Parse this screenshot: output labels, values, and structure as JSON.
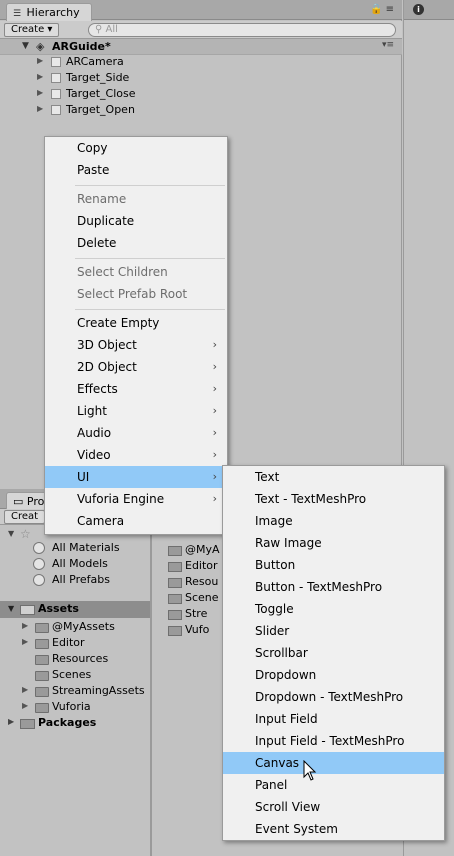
{
  "hierarchy": {
    "tab_label": "Hierarchy",
    "create_label": "Create ▾",
    "search_placeholder": "All",
    "scene_name": "ARGuide*",
    "items": [
      "ARCamera",
      "Target_Side",
      "Target_Close",
      "Target_Open"
    ]
  },
  "context_menu": {
    "copy": "Copy",
    "paste": "Paste",
    "rename": "Rename",
    "duplicate": "Duplicate",
    "delete": "Delete",
    "select_children": "Select Children",
    "select_prefab_root": "Select Prefab Root",
    "create_empty": "Create Empty",
    "object_3d": "3D Object",
    "object_2d": "2D Object",
    "effects": "Effects",
    "light": "Light",
    "audio": "Audio",
    "video": "Video",
    "ui": "UI",
    "vuforia": "Vuforia Engine",
    "camera": "Camera"
  },
  "ui_submenu": {
    "items": [
      "Text",
      "Text - TextMeshPro",
      "Image",
      "Raw Image",
      "Button",
      "Button - TextMeshPro",
      "Toggle",
      "Slider",
      "Scrollbar",
      "Dropdown",
      "Dropdown - TextMeshPro",
      "Input Field",
      "Input Field - TextMeshPro",
      "Canvas",
      "Panel",
      "Scroll View",
      "Event System"
    ],
    "highlighted": "Canvas"
  },
  "project": {
    "tab_label": "Pro",
    "create_label": "Creat",
    "favorites": [
      "All Materials",
      "All Models",
      "All Prefabs"
    ],
    "assets_label": "Assets",
    "asset_folders": [
      "@MyAssets",
      "Editor",
      "Resources",
      "Scenes",
      "StreamingAssets",
      "Vuforia"
    ],
    "packages_label": "Packages",
    "right_folders": [
      "@MyA",
      "Editor",
      "Resou",
      "Scene",
      "Stre",
      "Vufo"
    ]
  },
  "colors": {
    "highlight": "#91c9f7",
    "panel_bg": "#c2c2c2",
    "menu_bg": "#f0f0f0"
  }
}
